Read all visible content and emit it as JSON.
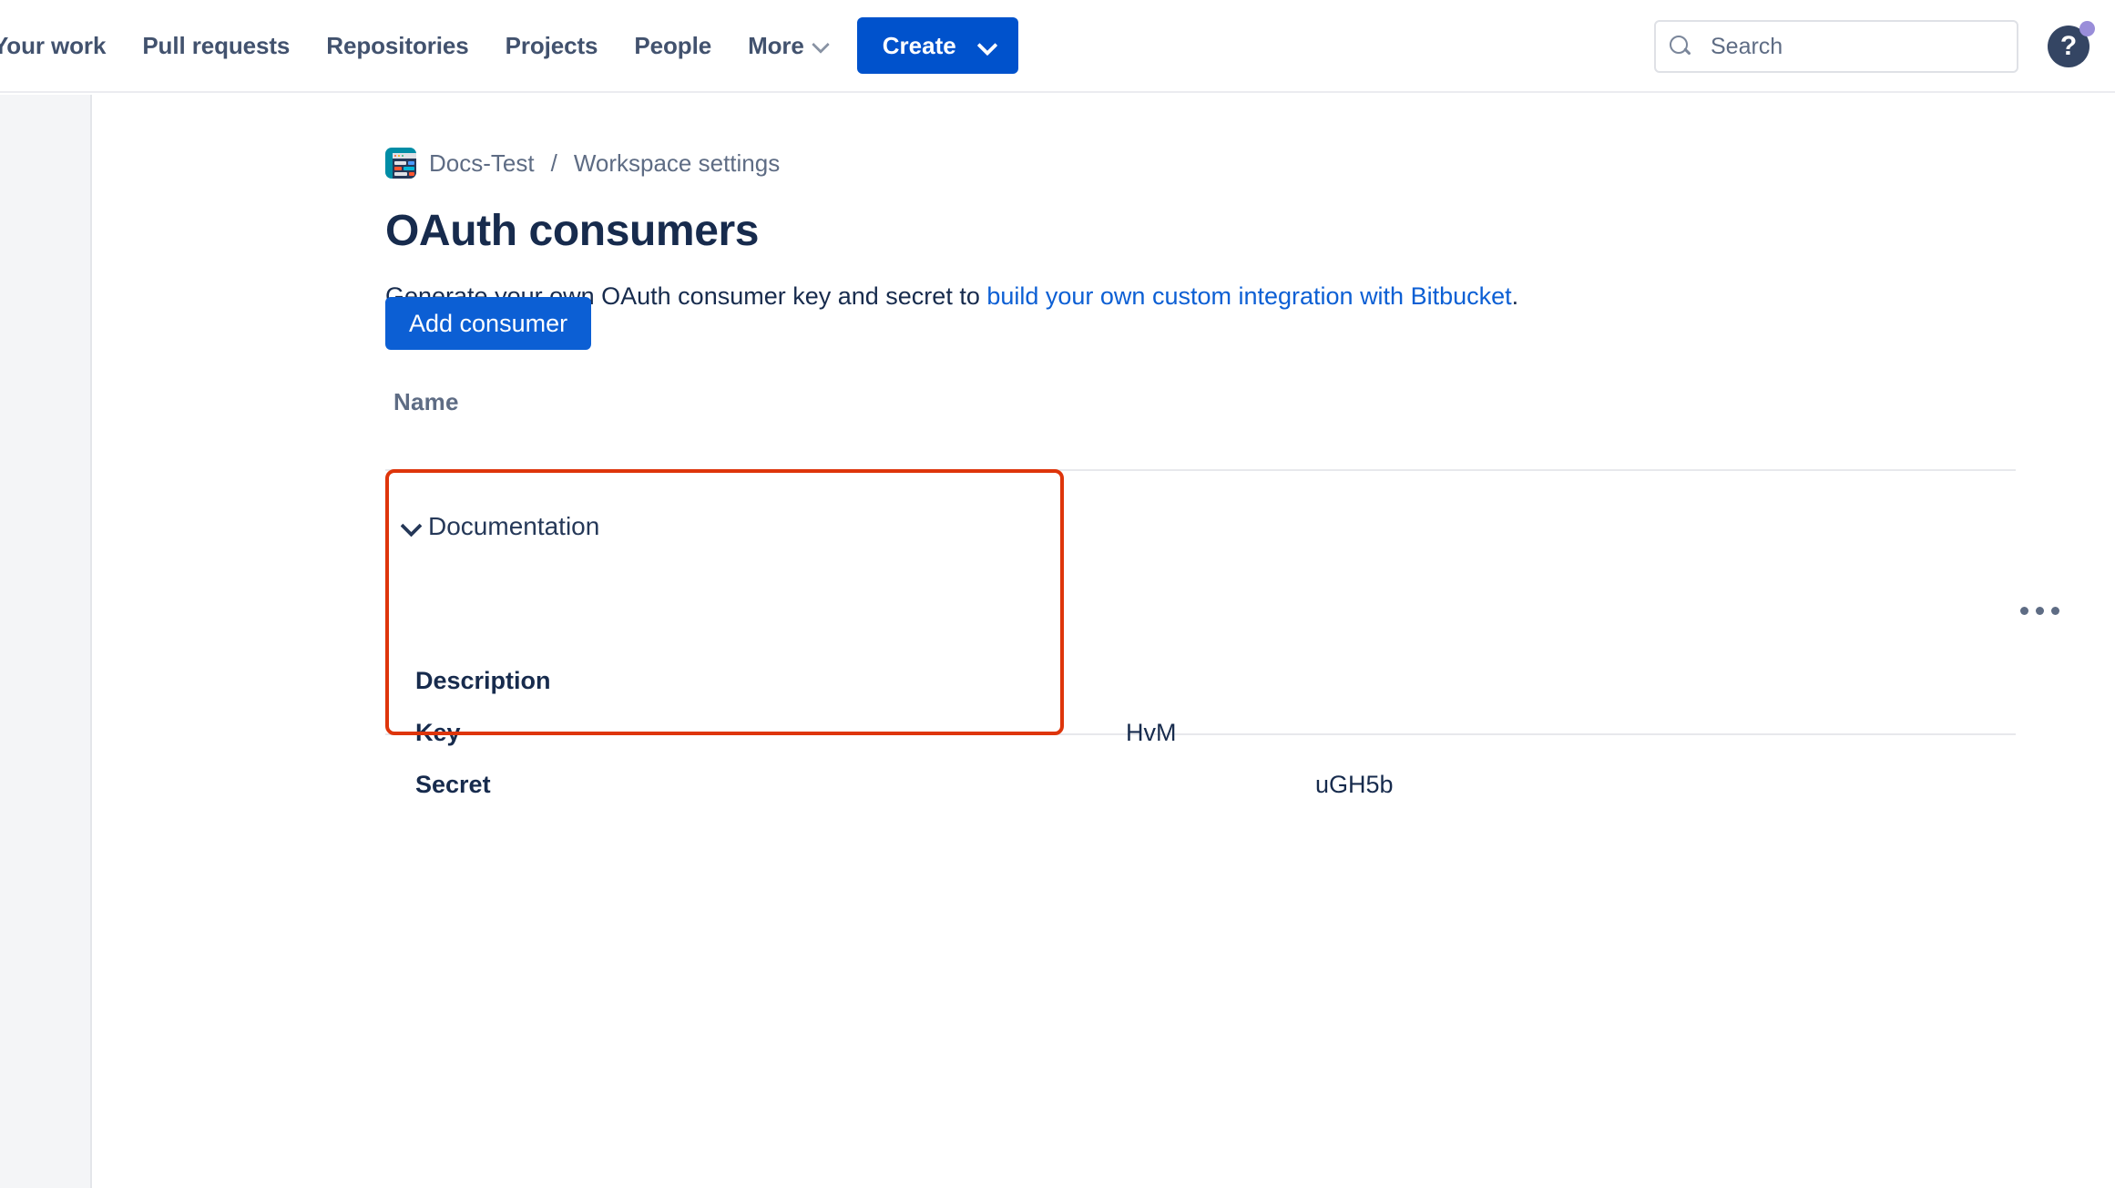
{
  "topnav": {
    "links": [
      {
        "label": "Your work",
        "icon": null
      },
      {
        "label": "Pull requests",
        "icon": null
      },
      {
        "label": "Repositories",
        "icon": null
      },
      {
        "label": "Projects",
        "icon": null
      },
      {
        "label": "People",
        "icon": null
      },
      {
        "label": "More",
        "icon": "chevron-down-icon"
      }
    ],
    "create_label": "Create",
    "create_icon": "chevron-down-icon",
    "create_bg": "#0052cc",
    "search": {
      "placeholder": "Search",
      "value": "",
      "icon": "search-icon"
    },
    "help": {
      "glyph": "?",
      "icon": "help-icon",
      "badge_color": "#998dd9",
      "bg": "#344563"
    }
  },
  "breadcrumb": {
    "workspace_icon": "workspace-avatar-icon",
    "workspace": "Docs-Test",
    "separator": "/",
    "current": "Workspace settings"
  },
  "page": {
    "title": "OAuth consumers",
    "description_prefix": "Generate your own OAuth consumer key and secret to ",
    "description_link": "build your own custom integration with Bitbucket",
    "description_suffix": ".",
    "link_color": "#0c5fd4",
    "title_color": "#172b4d"
  },
  "actions": {
    "add_consumer_label": "Add consumer",
    "add_consumer_bg": "#0c5fd4"
  },
  "table": {
    "columns": [
      "Name"
    ],
    "rows": [
      {
        "name": "Documentation",
        "expanded": true,
        "expand_icon": "chevron-down-icon",
        "more_icon": "more-options-icon",
        "details": [
          {
            "label": "Description",
            "value": ""
          },
          {
            "label": "Key",
            "value": "HvM"
          },
          {
            "label": "Secret",
            "value": "uGH5b"
          }
        ]
      }
    ]
  },
  "highlight": {
    "color": "#de350b"
  }
}
